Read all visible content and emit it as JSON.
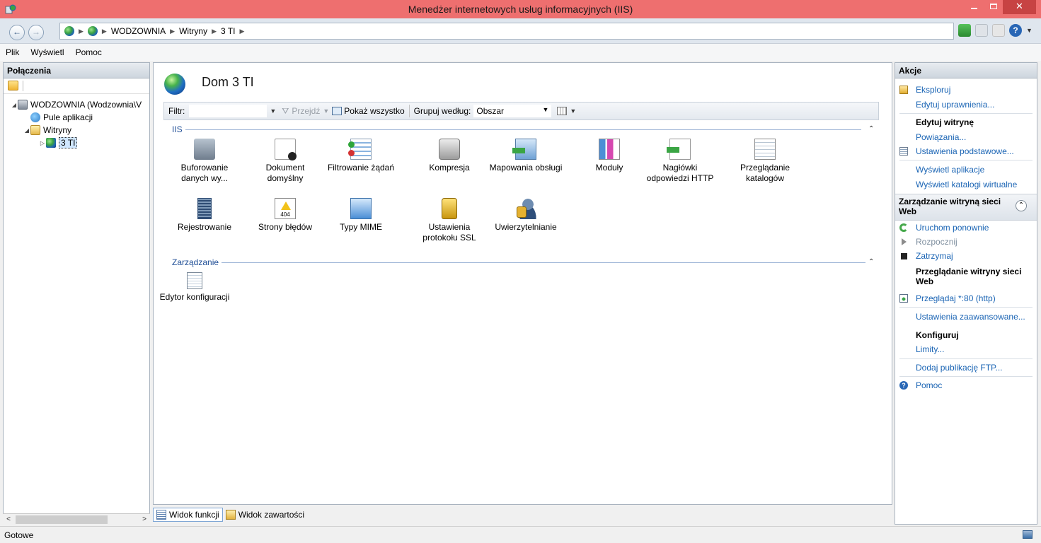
{
  "window": {
    "title": "Menedżer internetowych usług informacyjnych (IIS)"
  },
  "address": {
    "crumbs": [
      "WODZOWNIA",
      "Witryny",
      "3 TI"
    ]
  },
  "menu": {
    "items": [
      "Plik",
      "Wyświetl",
      "Pomoc"
    ]
  },
  "connections": {
    "title": "Połączenia",
    "tree": [
      {
        "label": "WODZOWNIA (Wodzownia\\V",
        "icon": "server-icon",
        "expanded": true
      },
      {
        "label": "Pule aplikacji",
        "icon": "app-pool-icon"
      },
      {
        "label": "Witryny",
        "icon": "sites-folder-icon",
        "expanded": true
      },
      {
        "label": "3 TI",
        "icon": "globe-icon",
        "selected": true
      }
    ]
  },
  "content": {
    "title": "Dom 3 TI",
    "filter_bar": {
      "filter_label": "Filtr:",
      "go_label": "Przejdź",
      "show_all_label": "Pokaż wszystko",
      "group_by_label": "Grupuj według:",
      "group_by_value": "Obszar"
    },
    "sections": [
      {
        "name": "IIS",
        "features": [
          {
            "label": "Buforowanie danych wy...",
            "icon": "output-caching-icon"
          },
          {
            "label": "Dokument domyślny",
            "icon": "default-document-icon"
          },
          {
            "label": "Filtrowanie żądań",
            "icon": "request-filtering-icon"
          },
          {
            "label": "Kompresja",
            "icon": "compression-icon"
          },
          {
            "label": "Mapowania obsługi",
            "icon": "handler-mappings-icon"
          },
          {
            "label": "Moduły",
            "icon": "modules-icon"
          },
          {
            "label": "Nagłówki odpowiedzi HTTP",
            "icon": "http-response-headers-icon"
          },
          {
            "label": "Przeglądanie katalogów",
            "icon": "directory-browsing-icon"
          },
          {
            "label": "Rejestrowanie",
            "icon": "logging-icon"
          },
          {
            "label": "Strony błędów",
            "icon": "error-pages-icon"
          },
          {
            "label": "Typy MIME",
            "icon": "mime-types-icon"
          },
          {
            "label": "Ustawienia protokołu SSL",
            "icon": "ssl-settings-icon"
          },
          {
            "label": "Uwierzytelnianie",
            "icon": "authentication-icon"
          }
        ]
      },
      {
        "name": "Zarządzanie",
        "features": [
          {
            "label": "Edytor konfiguracji",
            "icon": "configuration-editor-icon"
          }
        ]
      }
    ],
    "error_icon_text": "404",
    "bottom_tabs": [
      "Widok funkcji",
      "Widok zawartości"
    ]
  },
  "actions": {
    "title": "Akcje",
    "explore": "Eksploruj",
    "edit_permissions": "Edytuj uprawnienia...",
    "edit_site_heading": "Edytuj witrynę",
    "bindings": "Powiązania...",
    "basic_settings": "Ustawienia podstawowe...",
    "view_applications": "Wyświetl aplikacje",
    "view_virtual_dirs": "Wyświetl katalogi wirtualne",
    "manage_site_section": "Zarządzanie witryną sieci Web",
    "restart": "Uruchom ponownie",
    "start": "Rozpocznij",
    "stop": "Zatrzymaj",
    "browse_heading": "Przeglądanie witryny sieci Web",
    "browse_80": "Przeglądaj *:80 (http)",
    "advanced_settings": "Ustawienia zaawansowane...",
    "configure_heading": "Konfiguruj",
    "limits": "Limity...",
    "add_ftp": "Dodaj publikację FTP...",
    "help": "Pomoc"
  },
  "status": {
    "text": "Gotowe"
  },
  "colors": {
    "titlebar": "#ee6f6f",
    "close_button": "#c74343",
    "link": "#1a64b4"
  }
}
